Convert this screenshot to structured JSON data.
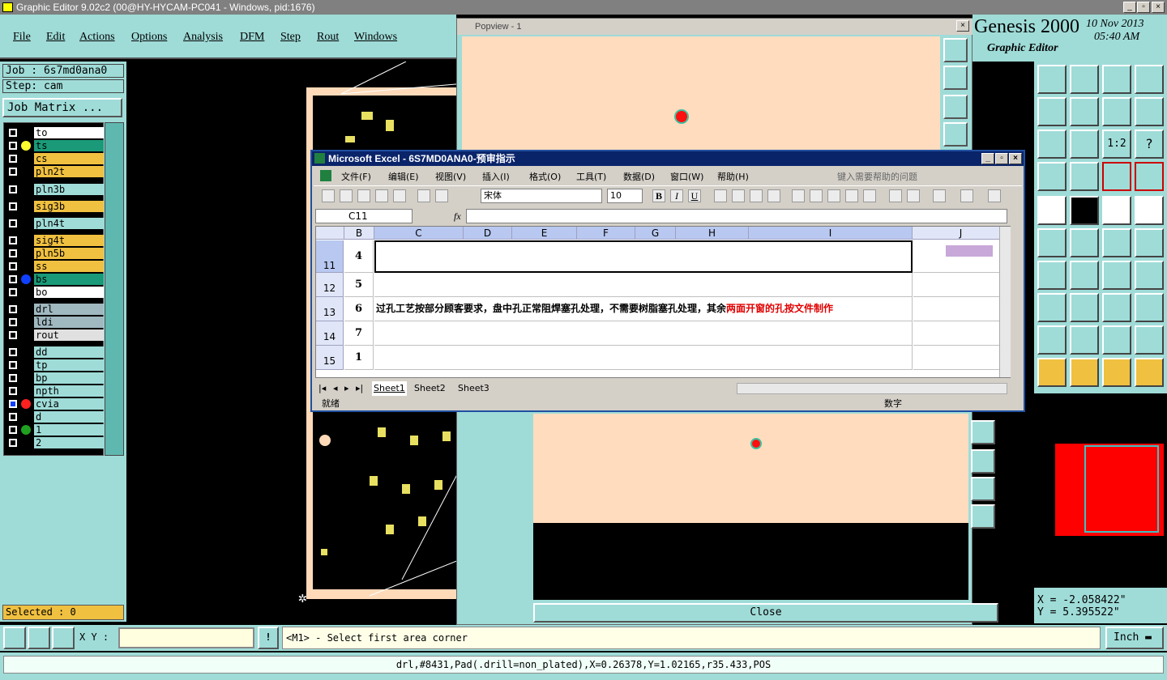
{
  "window": {
    "title": "Graphic Editor 9.02c2 (00@HY-HYCAM-PC041 - Windows, pid:1676)"
  },
  "menu": [
    "File",
    "Edit",
    "Actions",
    "Options",
    "Analysis",
    "DFM",
    "Step",
    "Rout",
    "Windows"
  ],
  "job": {
    "job_label": "Job : 6s7md0ana0",
    "step_label": "Step: cam",
    "matrix_button": "Job Matrix ..."
  },
  "layers": [
    {
      "name": "to",
      "color": "#ffffff",
      "dot": ""
    },
    {
      "name": "ts",
      "color": "#1a9a78",
      "dot": "#ffff30"
    },
    {
      "name": "cs",
      "color": "#f0c040",
      "dot": ""
    },
    {
      "name": "pln2t",
      "color": "#f0c040",
      "dot": ""
    },
    {
      "name": "pln3b",
      "color": "#9fdcd8",
      "dot": ""
    },
    {
      "name": "sig3b",
      "color": "#f0c040",
      "dot": ""
    },
    {
      "name": "pln4t",
      "color": "#9fdcd8",
      "dot": ""
    },
    {
      "name": "sig4t",
      "color": "#f0c040",
      "dot": ""
    },
    {
      "name": "pln5b",
      "color": "#f0c040",
      "dot": ""
    },
    {
      "name": "ss",
      "color": "#f0c040",
      "dot": ""
    },
    {
      "name": "bs",
      "color": "#1a9a78",
      "dot": "#1040ff"
    },
    {
      "name": "bo",
      "color": "#ffffff",
      "dot": ""
    },
    {
      "name": "drl",
      "color": "#a0b8c0",
      "dot": ""
    },
    {
      "name": "ldi",
      "color": "#a0b8c0",
      "dot": ""
    },
    {
      "name": "rout",
      "color": "#e0e0e0",
      "dot": ""
    },
    {
      "name": "dd",
      "color": "#9fdcd8",
      "dot": ""
    },
    {
      "name": "tp",
      "color": "#9fdcd8",
      "dot": ""
    },
    {
      "name": "bp",
      "color": "#9fdcd8",
      "dot": ""
    },
    {
      "name": "npth",
      "color": "#9fdcd8",
      "dot": ""
    },
    {
      "name": "cvia",
      "color": "#9fdcd8",
      "dot": "#ff2020"
    },
    {
      "name": "d",
      "color": "#9fdcd8",
      "dot": ""
    },
    {
      "name": "1",
      "color": "#9fdcd8",
      "dot": "#20a020"
    },
    {
      "name": "2",
      "color": "#9fdcd8",
      "dot": ""
    }
  ],
  "selected": "Selected : 0",
  "popview": {
    "title": "Popview - 1",
    "close_label": "Close"
  },
  "excel": {
    "title": "Microsoft Excel - 6S7MD0ANA0-预审指示",
    "menu": [
      "文件(F)",
      "编辑(E)",
      "视图(V)",
      "插入(I)",
      "格式(O)",
      "工具(T)",
      "数据(D)",
      "窗口(W)",
      "帮助(H)"
    ],
    "help_placeholder": "键入需要帮助的问题",
    "font": "宋体",
    "font_size": "10",
    "name_box": "C11",
    "fx": "fx",
    "columns": [
      "B",
      "C",
      "D",
      "E",
      "F",
      "G",
      "H",
      "I",
      "J"
    ],
    "rows": [
      {
        "num": "11",
        "b": "4",
        "text": "",
        "red": ""
      },
      {
        "num": "12",
        "b": "5",
        "text": "",
        "red": ""
      },
      {
        "num": "13",
        "b": "6",
        "text": "过孔工艺按部分顾客要求，盘中孔正常阻焊塞孔处理，不需要树脂塞孔处理，其余",
        "red": "两面开窗的孔按文件制作"
      },
      {
        "num": "14",
        "b": "7",
        "text": "",
        "red": ""
      },
      {
        "num": "15",
        "b": "1",
        "text": "",
        "red": ""
      }
    ],
    "sheets": [
      "Sheet1",
      "Sheet2",
      "Sheet3"
    ],
    "status_left": "就绪",
    "status_right": "数字"
  },
  "genesis": {
    "brand": "Genesis 2000",
    "subtitle": "Graphic Editor",
    "date": "10 Nov 2013",
    "time": "05:40 AM"
  },
  "coords": {
    "x": "X = -2.058422\"",
    "y": "Y = 5.395522\""
  },
  "command": {
    "xy_label": "X Y :",
    "xy_value": "",
    "prompt": "<M1> - Select first area corner",
    "units": "Inch"
  },
  "footer_info": "drl,#8431,Pad(.drill=non_plated),X=0.26378,Y=1.02165,r35.433,POS"
}
